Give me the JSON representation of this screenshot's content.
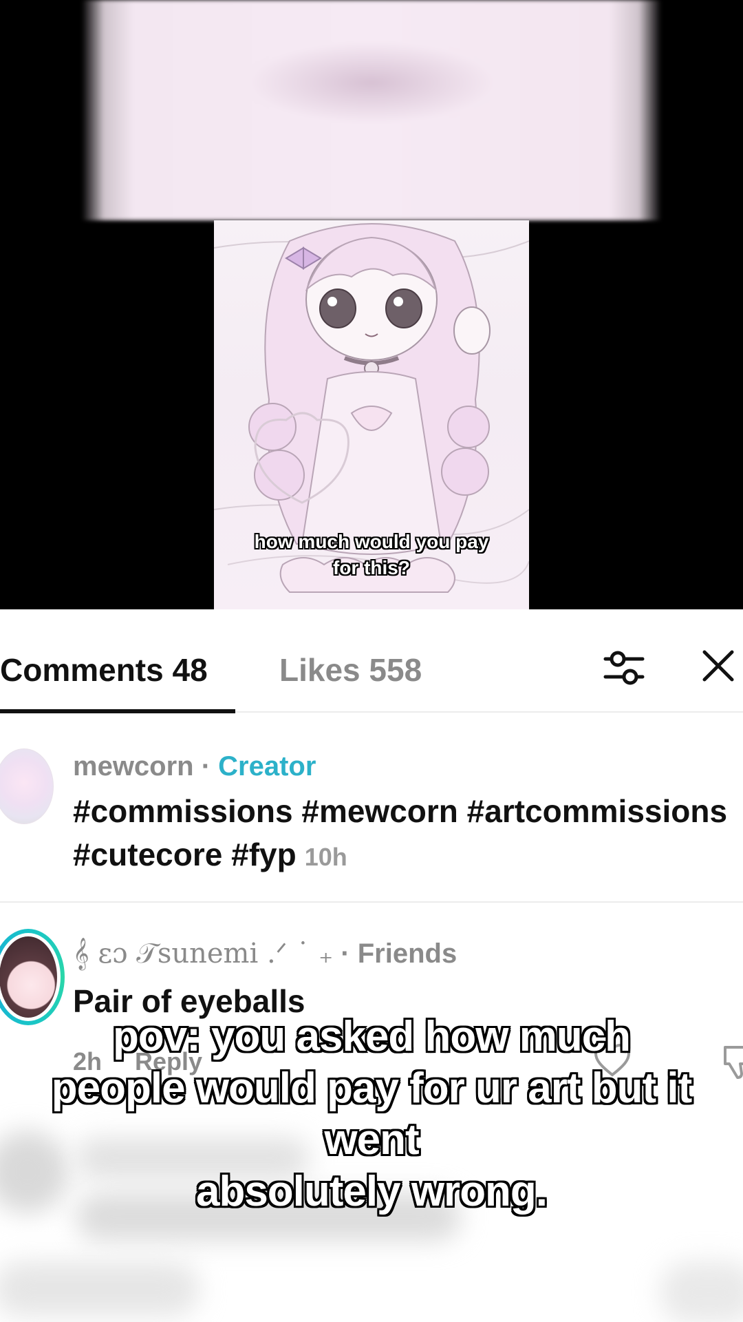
{
  "video": {
    "caption_line1": "how much would you pay",
    "caption_line2": "for this?"
  },
  "tabs": {
    "comments_label": "Comments 48",
    "likes_label": "Likes 558"
  },
  "icons": {
    "filter": "filter-sliders-icon",
    "close": "close-icon",
    "heart": "heart-icon",
    "dislike": "dislike-icon"
  },
  "comments": [
    {
      "author": "mewcorn",
      "separator": " · ",
      "badge": "Creator",
      "text": "#commissions #mewcorn #artcommissions #cutecore #fyp",
      "time": "10h"
    },
    {
      "author": "𝄞 ɛɔ 𝒯sunemi .ᐟ ˙ ₊",
      "separator": " · ",
      "badge": "Friends",
      "text": "Pair of eyeballs",
      "time": "2h",
      "reply_label": "Reply"
    }
  ],
  "overlay": {
    "line1": "pov: you asked how much",
    "line2": "people would pay for ur art but it went",
    "line3": "absolutely wrong."
  },
  "colors": {
    "creator_badge": "#2cb1c9",
    "muted_text": "#8a8a8a",
    "primary_text": "#111111",
    "avatar_ring": "#19c4c8"
  }
}
